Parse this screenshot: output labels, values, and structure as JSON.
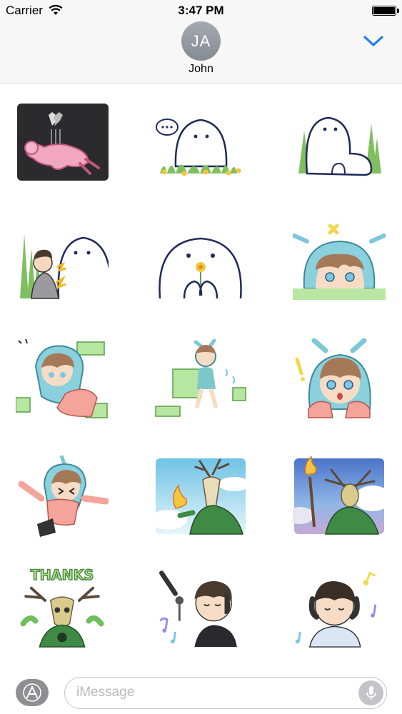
{
  "status_bar": {
    "carrier": "Carrier",
    "time": "3:47 PM",
    "battery_level": 1.0
  },
  "conversation": {
    "initials": "JA",
    "name": "John"
  },
  "sticker_text": "THANKS",
  "stickers": [
    {
      "name": "sticker-heartbroken-girl"
    },
    {
      "name": "sticker-ghost-speech"
    },
    {
      "name": "sticker-ghost-sitting"
    },
    {
      "name": "sticker-boy-scared-ghost"
    },
    {
      "name": "sticker-ghost-flower"
    },
    {
      "name": "sticker-hooded-girl-peeking"
    },
    {
      "name": "sticker-girl-blocks"
    },
    {
      "name": "sticker-girl-jumping-blocks"
    },
    {
      "name": "sticker-girl-surprised"
    },
    {
      "name": "sticker-girl-falling"
    },
    {
      "name": "sticker-deer-skull-flame"
    },
    {
      "name": "sticker-deer-torch"
    },
    {
      "name": "sticker-thanks-deer"
    },
    {
      "name": "sticker-boy-headphones-mic"
    },
    {
      "name": "sticker-boy-headphones-music"
    }
  ],
  "message_input": {
    "placeholder": "iMessage"
  },
  "icons": {
    "app_store": "app-store-icon",
    "mic": "microphone-icon",
    "wifi": "wifi-icon",
    "expand": "chevron-down-icon"
  }
}
